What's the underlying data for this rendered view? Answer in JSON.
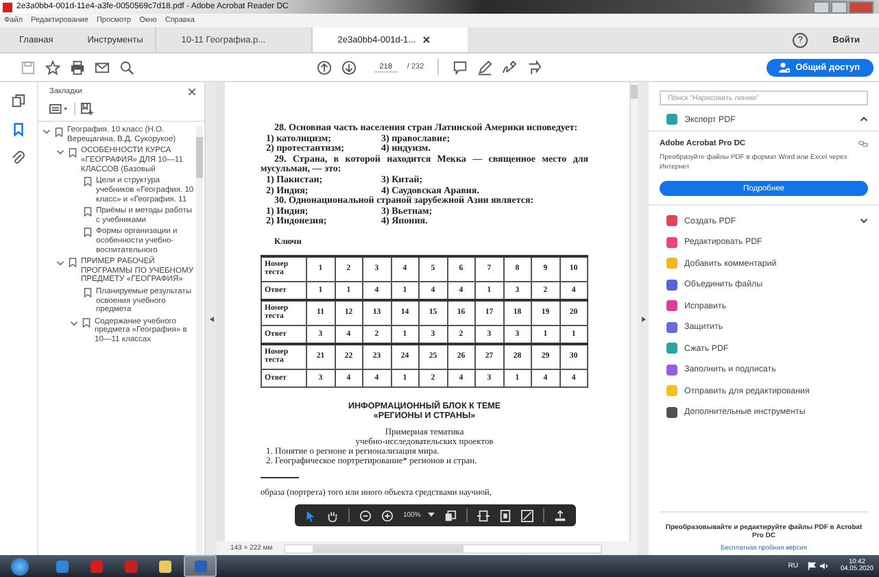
{
  "window": {
    "title": "2e3a0bb4-001d-11e4-a3fe-0050569c7d18.pdf - Adobe Acrobat Reader DC"
  },
  "menu": [
    "Файл",
    "Редактирование",
    "Просмотр",
    "Окно",
    "Справка"
  ],
  "nav": [
    "Главная",
    "Инструменты"
  ],
  "tabs": [
    {
      "label": "10-11 Географиа.р...",
      "selected": false,
      "closable": false
    },
    {
      "label": "2e3a0bb4-001d-1...",
      "selected": true,
      "closable": true
    }
  ],
  "help": "?",
  "signin": "Войти",
  "toolbar": {
    "page_current": "218",
    "page_total": "/ 232",
    "share": "Общий доступ"
  },
  "bookmarks": {
    "title": "Закладки",
    "items": [
      {
        "label": "География. 10 класс (Н.О. Верещагина, В.Д. Сукорукое)",
        "expanded": true,
        "children": [
          {
            "label": "ОСОБЕННОСТИ КУРСА «ГЕОГРАФИЯ» ДЛЯ 10—11 КЛАССОВ (Базовый",
            "expanded": true,
            "children": [
              {
                "label": "Цели и структура учебников «География. 10 класс» и «География. 11"
              },
              {
                "label": "Приёмы и методы работы с учебниками"
              },
              {
                "label": "Формы организации и особенности учебно-воспитательного"
              }
            ]
          },
          {
            "label": "ПРИМЕР РАБОЧЕЙ ПРОГРАММЫ ПО УЧЕБНОМУ ПРЕДМЕТУ «ГЕОГРАФИЯ»",
            "expanded": true,
            "children": [
              {
                "label": "Планируемые результаты освоения учебного предмета"
              },
              {
                "label": "Содержание учебного предмета «География» в 10—11 классах",
                "expanded": true
              }
            ]
          }
        ]
      }
    ]
  },
  "document": {
    "questions": [
      {
        "text": "28. Основная часть населения стран Латинской Америки исповедует:",
        "options": [
          "1) католицизм;",
          "3) православие;",
          "2) протестантизм;",
          "4) индуизм."
        ]
      },
      {
        "text": "29. Страна, в которой находится Мекка — священное место для мусульман, — это:",
        "options": [
          "1) Пакистан;",
          "3) Китай;",
          "2) Индия;",
          "4) Саудовская Аравия."
        ]
      },
      {
        "text": "30. Однонациональной страной зарубежной Азии является:",
        "options": [
          "1) Индия;",
          "3) Вьетнам;",
          "2) Индонезия;",
          "4) Япония."
        ]
      }
    ],
    "keys_title": "Ключи",
    "key_table": [
      [
        "Номер теста",
        "1",
        "2",
        "3",
        "4",
        "5",
        "6",
        "7",
        "8",
        "9",
        "10"
      ],
      [
        "Ответ",
        "1",
        "1",
        "4",
        "1",
        "4",
        "4",
        "1",
        "3",
        "2",
        "4"
      ],
      [
        "Номер теста",
        "11",
        "12",
        "13",
        "14",
        "15",
        "16",
        "17",
        "18",
        "19",
        "20"
      ],
      [
        "Ответ",
        "3",
        "4",
        "2",
        "1",
        "3",
        "2",
        "3",
        "3",
        "1",
        "1"
      ],
      [
        "Номер теста",
        "21",
        "22",
        "23",
        "24",
        "25",
        "26",
        "27",
        "28",
        "29",
        "30"
      ],
      [
        "Ответ",
        "3",
        "4",
        "4",
        "1",
        "2",
        "4",
        "3",
        "1",
        "4",
        "4"
      ]
    ],
    "heading": [
      "ИНФОРМАЦИОННЫЙ БЛОК К ТЕМЕ",
      "«РЕГИОНЫ И СТРАНЫ»"
    ],
    "subheading": [
      "Примерная тематика",
      "учебно-исследовательских проектов"
    ],
    "topics": [
      "1. Понятие о регионе и регионализация мира.",
      "2. Географическое портретирование* регионов и стран."
    ],
    "footnote": "образа (портрета) того или иного объекта средствами научной,",
    "page_size": "143 × 222 мм"
  },
  "float_toolbar": {
    "zoom": "100%"
  },
  "tools_panel": {
    "search_placeholder": "Поиск \"Нарисовать линию\"",
    "export": {
      "label": "Экспорт PDF",
      "expanded": true,
      "product": "Adobe Acrobat Pro DC",
      "description": "Преобразуйте файлы PDF в формат Word или Excel через Интернет",
      "button": "Подробнее"
    },
    "tools": [
      {
        "label": "Создать PDF",
        "color": "#e0464f",
        "expanded": false
      },
      {
        "label": "Редактировать PDF",
        "color": "#e8467c"
      },
      {
        "label": "Добавить комментарий",
        "color": "#f2b71e"
      },
      {
        "label": "Объединить файлы",
        "color": "#5a64d8"
      },
      {
        "label": "Исправить",
        "color": "#e03a9a"
      },
      {
        "label": "Защитить",
        "color": "#6a6ad8"
      },
      {
        "label": "Сжать PDF",
        "color": "#2aa3a3"
      },
      {
        "label": "Заполнить и подписать",
        "color": "#9a5ce0"
      },
      {
        "label": "Отправить для редактирования",
        "color": "#f2c21e"
      },
      {
        "label": "Дополнительные инструменты",
        "color": "#505050"
      }
    ],
    "promo": "Преобразовывайте и редактируйте файлы PDF в Acrobat Pro DC",
    "trial": "Бесплатная пробная версия"
  },
  "taskbar": {
    "apps": [
      {
        "kind": "ie",
        "selected": false
      },
      {
        "kind": "opera",
        "selected": false
      },
      {
        "kind": "acrobat",
        "selected": false
      },
      {
        "kind": "explorer",
        "selected": false
      },
      {
        "kind": "word",
        "selected": true
      }
    ],
    "language": "RU",
    "time": "10:42",
    "date": "04.05.2020"
  }
}
